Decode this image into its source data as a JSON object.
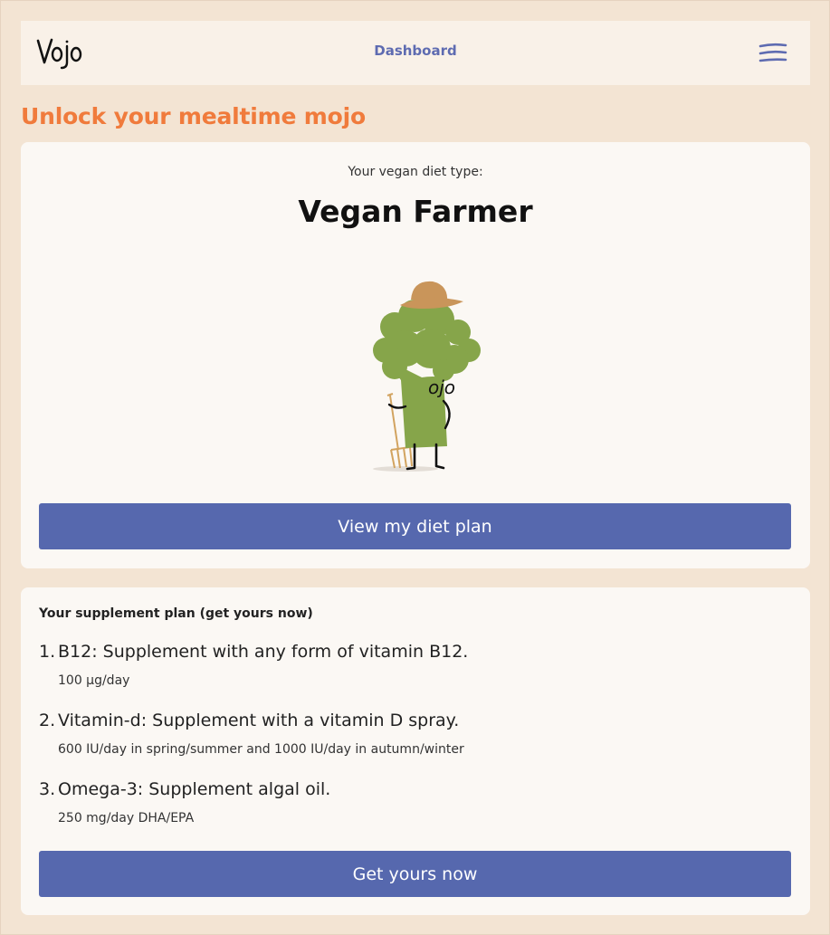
{
  "header": {
    "logo_text": "Vojo",
    "nav_link": "Dashboard",
    "menu_icon": "hamburger-icon"
  },
  "page_title": "Unlock your mealtime mojo",
  "diet_card": {
    "label": "Your vegan diet type:",
    "diet_type": "Vegan Farmer",
    "mascot_text": "ojo",
    "button_label": "View my diet plan"
  },
  "supplement_card": {
    "heading": "Your supplement plan (get yours now)",
    "items": [
      {
        "number": "1.",
        "title": "B12: Supplement with any form of vitamin B12.",
        "dose": "100 μg/day"
      },
      {
        "number": "2.",
        "title": "Vitamin-d: Supplement with a vitamin D spray.",
        "dose": "600 IU/day in spring/summer and 1000 IU/day in autumn/winter"
      },
      {
        "number": "3.",
        "title": "Omega-3: Supplement algal oil.",
        "dose": "250 mg/day DHA/EPA"
      }
    ],
    "button_label": "Get yours now"
  },
  "colors": {
    "background": "#f3e4d3",
    "accent_orange": "#f07b3c",
    "button_blue": "#5668ae",
    "nav_link": "#5e6bb1",
    "broccoli_green": "#86a54a",
    "hat_tan": "#c9955a"
  }
}
